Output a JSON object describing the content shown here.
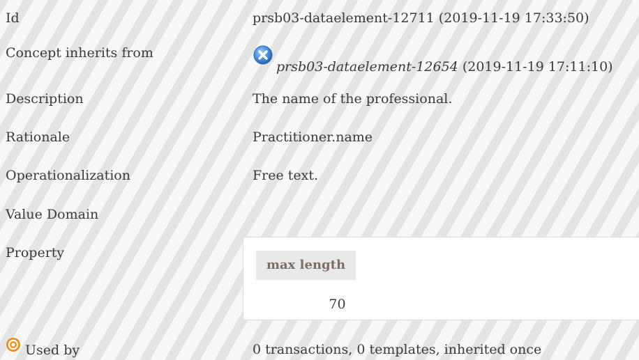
{
  "rows": {
    "id": {
      "label": "Id",
      "value": "prsb03-dataelement-12711 (2019-11-19 17:33:50)"
    },
    "concept_inherits_from": {
      "label": "Concept inherits from",
      "ref": "prsb03-dataelement-12654",
      "timestamp": " (2019-11-19 17:11:10)",
      "icon": "inherit-x-icon"
    },
    "description": {
      "label": "Description",
      "value": "The name of the professional."
    },
    "rationale": {
      "label": "Rationale",
      "value": "Practitioner.name"
    },
    "operationalization": {
      "label": "Operationalization",
      "value": "Free text."
    },
    "value_domain": {
      "label": "Value Domain",
      "value": ""
    },
    "property": {
      "label": "Property",
      "table_header": "max length",
      "table_value": "70"
    },
    "used_by": {
      "label": "Used by",
      "icon": "target-icon",
      "value": "0 transactions, 0 templates, inherited once"
    }
  },
  "colors": {
    "text": "#3a3a3a",
    "stripe_light": "#f7f7f7",
    "stripe_dark": "#e4e4e4",
    "icon_blue": "#4a90d9",
    "icon_orange": "#f08c1e"
  }
}
